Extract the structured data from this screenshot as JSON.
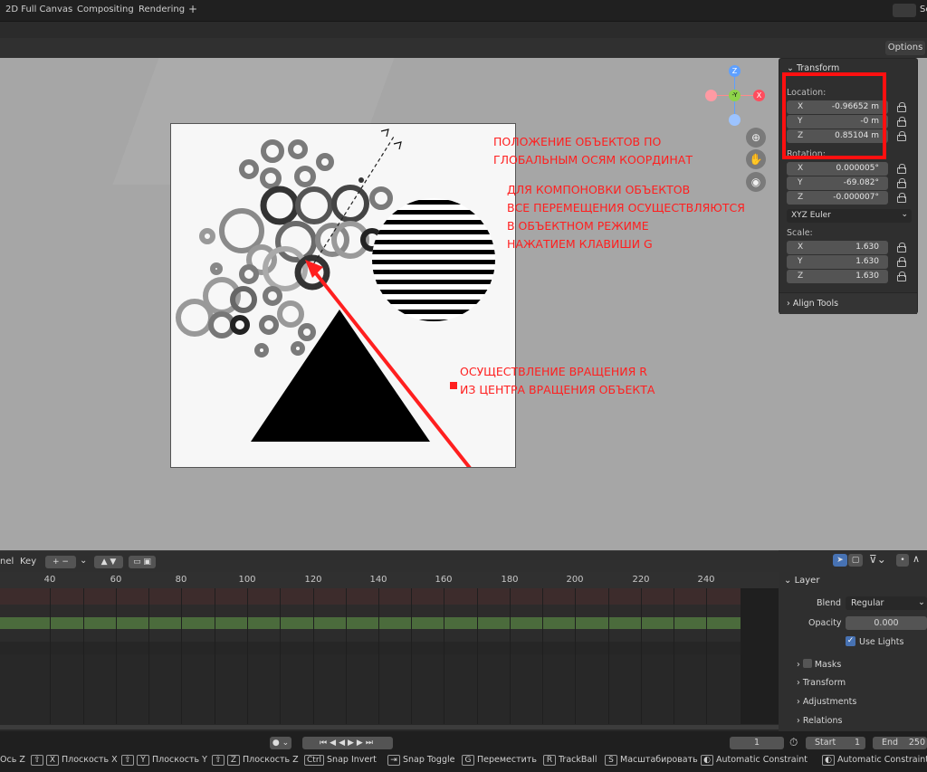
{
  "workspace_tabs": [
    "2D Full Canvas",
    "Compositing",
    "Rendering",
    "+"
  ],
  "top_right_label": "Sc",
  "options_label": "Options",
  "transform_panel": {
    "title": "Transform",
    "location_label": "Location:",
    "location": {
      "x": "-0.96652 m",
      "y": "-0 m",
      "z": "0.85104 m"
    },
    "rotation_label": "Rotation:",
    "rotation": {
      "x": "0.000005°",
      "y": "-69.082°",
      "z": "-0.000007°"
    },
    "rotation_mode": "XYZ Euler",
    "scale_label": "Scale:",
    "scale": {
      "x": "1.630",
      "y": "1.630",
      "z": "1.630"
    },
    "axis_x": "X",
    "axis_y": "Y",
    "axis_z": "Z",
    "align_tools": "Align Tools"
  },
  "gizmo": {
    "z": "Z",
    "y": "-Y",
    "x": "X"
  },
  "annotations": {
    "global_axes": "ПОЛОЖЕНИЕ ОБЪЕКТОВ ПО\nГЛОБАЛЬНЫМ ОСЯМ КООРДИНАТ",
    "move_hint": "ДЛЯ КОМПОНОВКИ ОБЪЕКТОВ\nВСЕ ПЕРЕМЕЩЕНИЯ ОСУЩЕСТВЛЯЮТСЯ\nВ ОБЪЕКТНОМ РЕЖИМЕ\nНАЖАТИЕМ КЛАВИШИ G",
    "rotate_hint": "ОСУЩЕСТВЛЕНИЕ ВРАЩЕНИЯ R\nИЗ ЦЕНТРА ВРАЩЕНИЯ ОБЪЕКТА"
  },
  "colors": {
    "annotation": "#ff1f1f",
    "viewport_bg": "#a6a6a6",
    "track_green": "#4b6b3c",
    "track_red": "#3d2c2c"
  },
  "timeline": {
    "menu_channel": "nel",
    "menu_key": "Key",
    "frames": [
      "40",
      "60",
      "80",
      "100",
      "120",
      "140",
      "160",
      "180",
      "200",
      "220",
      "240"
    ]
  },
  "layer_panel": {
    "title": "Layer",
    "blend_label": "Blend",
    "blend_value": "Regular",
    "opacity_label": "Opacity",
    "opacity_value": "0.000",
    "use_lights": "Use Lights",
    "sections": [
      "Masks",
      "Transform",
      "Adjustments",
      "Relations"
    ]
  },
  "playback": {
    "current_frame": "1",
    "start_label": "Start",
    "start_value": "1",
    "end_label": "End",
    "end_value": "250"
  },
  "statusbar": [
    {
      "keys": [],
      "label": "Ось Z"
    },
    {
      "keys": [
        "⇧",
        "X"
      ],
      "label": "Плоскость X"
    },
    {
      "keys": [
        "⇧",
        "Y"
      ],
      "label": "Плоскость Y"
    },
    {
      "keys": [
        "⇧",
        "Z"
      ],
      "label": "Плоскость Z"
    },
    {
      "keys": [
        "Ctrl"
      ],
      "label": "Snap Invert"
    },
    {
      "keys": [
        "⇥"
      ],
      "label": "Snap Toggle"
    },
    {
      "keys": [
        "G"
      ],
      "label": "Переместить"
    },
    {
      "keys": [
        "R"
      ],
      "label": "TrackBall"
    },
    {
      "keys": [
        "S"
      ],
      "label": "Масштабировать"
    },
    {
      "keys": [
        "◐"
      ],
      "label": "Automatic Constraint"
    },
    {
      "keys": [
        "◐"
      ],
      "label": "Automatic Constraint P"
    }
  ]
}
